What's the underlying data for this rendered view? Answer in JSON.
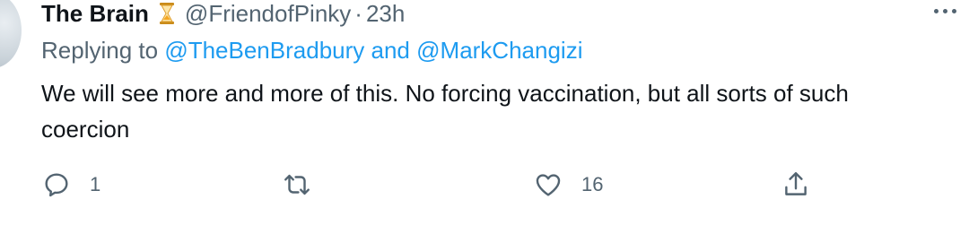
{
  "tweet": {
    "author_name": "The Brain",
    "author_badge_icon": "hourglass-icon",
    "handle": "@FriendofPinky",
    "separator": "·",
    "time": "23h",
    "replying_prefix": "Replying to",
    "replying_mention_1": "@TheBenBradbury",
    "replying_and": "and",
    "replying_mention_2": "@MarkChangizi",
    "text": "We will see more and more of this. No forcing vaccination, but all sorts of such coercion"
  },
  "actions": {
    "reply_icon": "reply-icon",
    "reply_count": "1",
    "retweet_icon": "retweet-icon",
    "like_icon": "heart-icon",
    "like_count": "16",
    "share_icon": "share-icon"
  },
  "colors": {
    "text": "#0f1419",
    "secondary": "#536471",
    "link": "#1d9bf0",
    "hourglass": "#f4a623"
  }
}
